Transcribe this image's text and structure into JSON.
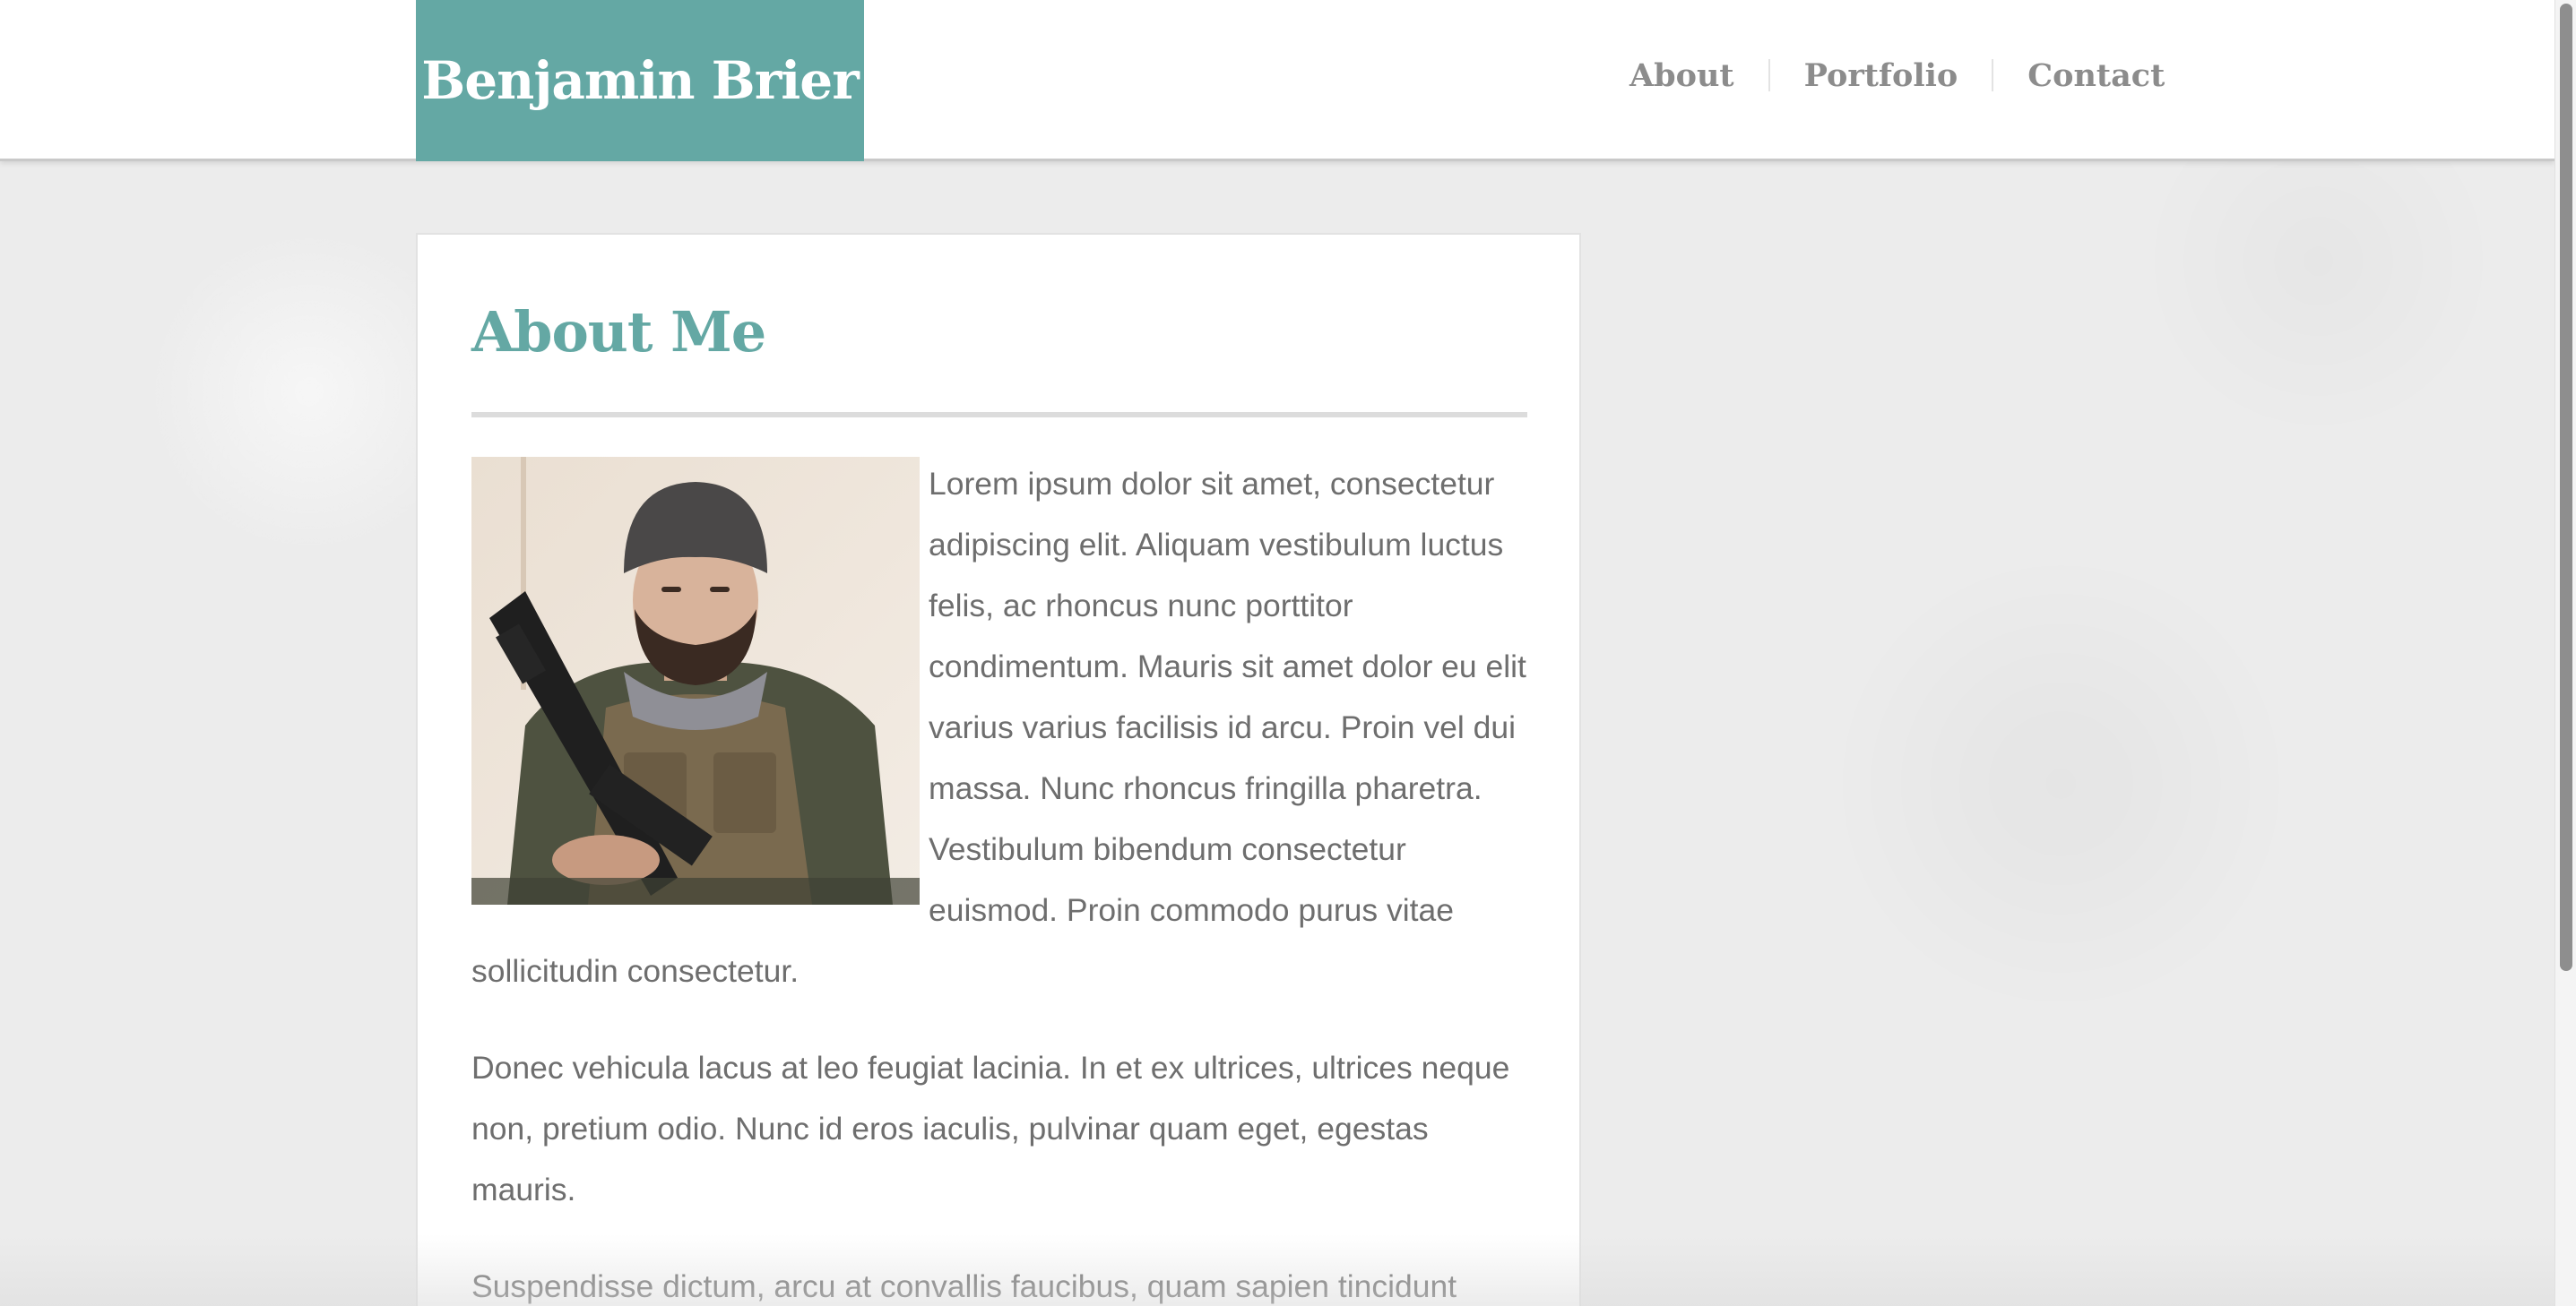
{
  "header": {
    "brand": "Benjamin Brier",
    "nav": [
      {
        "label": "About"
      },
      {
        "label": "Portfolio"
      },
      {
        "label": "Contact"
      }
    ]
  },
  "main": {
    "title": "About Me",
    "portrait_icon": "profile-photo",
    "paragraphs": [
      "Lorem ipsum dolor sit amet, consectetur adipiscing elit. Aliquam vestibulum luctus felis, ac rhoncus nunc porttitor condimentum. Mauris sit amet dolor eu elit varius varius facilisis id arcu. Proin vel dui massa. Nunc rhoncus fringilla pharetra. Vestibulum bibendum consectetur euismod. Proin commodo purus vitae sollicitudin consectetur.",
      "Donec vehicula lacus at leo feugiat lacinia. In et ex ultrices, ultrices neque non, pretium odio. Nunc id eros iaculis, pulvinar quam eget, egestas mauris.",
      "Suspendisse dictum, arcu at convallis faucibus, quam sapien tincidunt"
    ]
  },
  "colors": {
    "accent": "#64a8a4",
    "text": "#6e6e6e",
    "nav_text": "#8c8c8c",
    "background": "#ececec"
  }
}
